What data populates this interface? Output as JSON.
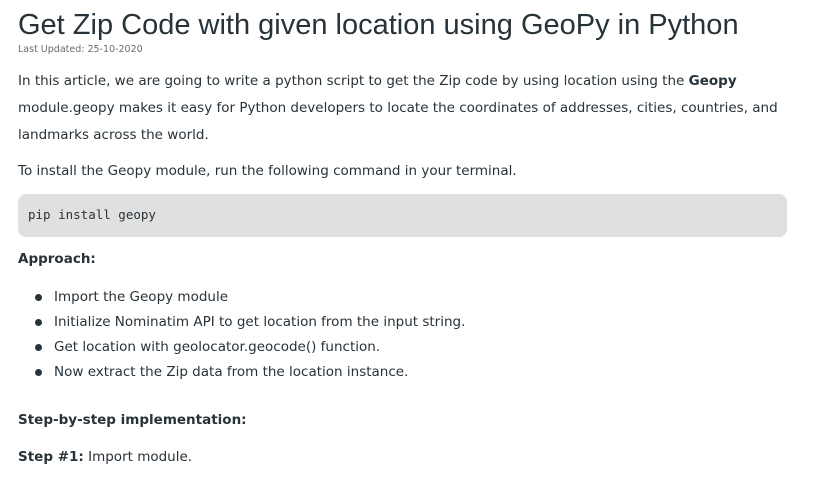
{
  "article": {
    "title": "Get Zip Code with given location using GeoPy in Python",
    "last_updated": "Last Updated: 25-10-2020",
    "intro_before_bold": "In this article, we are going to write a python script to get the Zip code by using location using the ",
    "intro_bold": "Geopy",
    "intro_after_bold": " module.geopy makes it easy for Python developers to locate the coordinates of addresses, cities, countries, and landmarks across the world.",
    "install_text": "To install the Geopy module, run the following command in your terminal.",
    "install_command": "pip install geopy",
    "approach_heading": "Approach:",
    "approach_items": [
      "Import the Geopy module",
      "Initialize Nominatim API to get location from the input string.",
      "Get location with geolocator.geocode() function.",
      "Now extract the Zip data from the location instance."
    ],
    "steps_heading": "Step-by-step implementation:",
    "step1_label": "Step #1:",
    "step1_text": " Import module."
  }
}
